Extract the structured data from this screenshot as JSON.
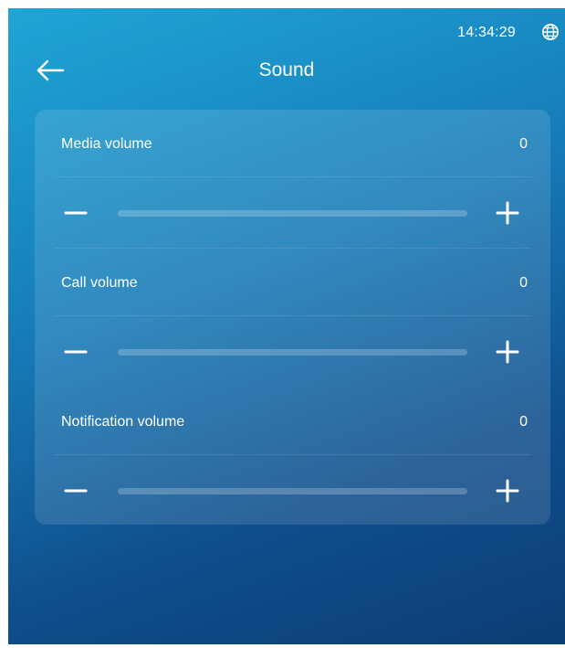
{
  "status_bar": {
    "time": "14:34:29",
    "network_icon": "globe-icon"
  },
  "header": {
    "back_icon": "arrow-left-icon",
    "title": "Sound"
  },
  "volume_settings": [
    {
      "label": "Media volume",
      "value": "0",
      "level_fraction": 0
    },
    {
      "label": "Call volume",
      "value": "0",
      "level_fraction": 0
    },
    {
      "label": "Notification volume",
      "value": "0",
      "level_fraction": 0
    }
  ],
  "controls": {
    "decrease_icon": "minus-icon",
    "increase_icon": "plus-icon"
  },
  "colors": {
    "background_top": "#1fa6d6",
    "background_bottom": "#0c3d74",
    "text": "#ffffff"
  }
}
